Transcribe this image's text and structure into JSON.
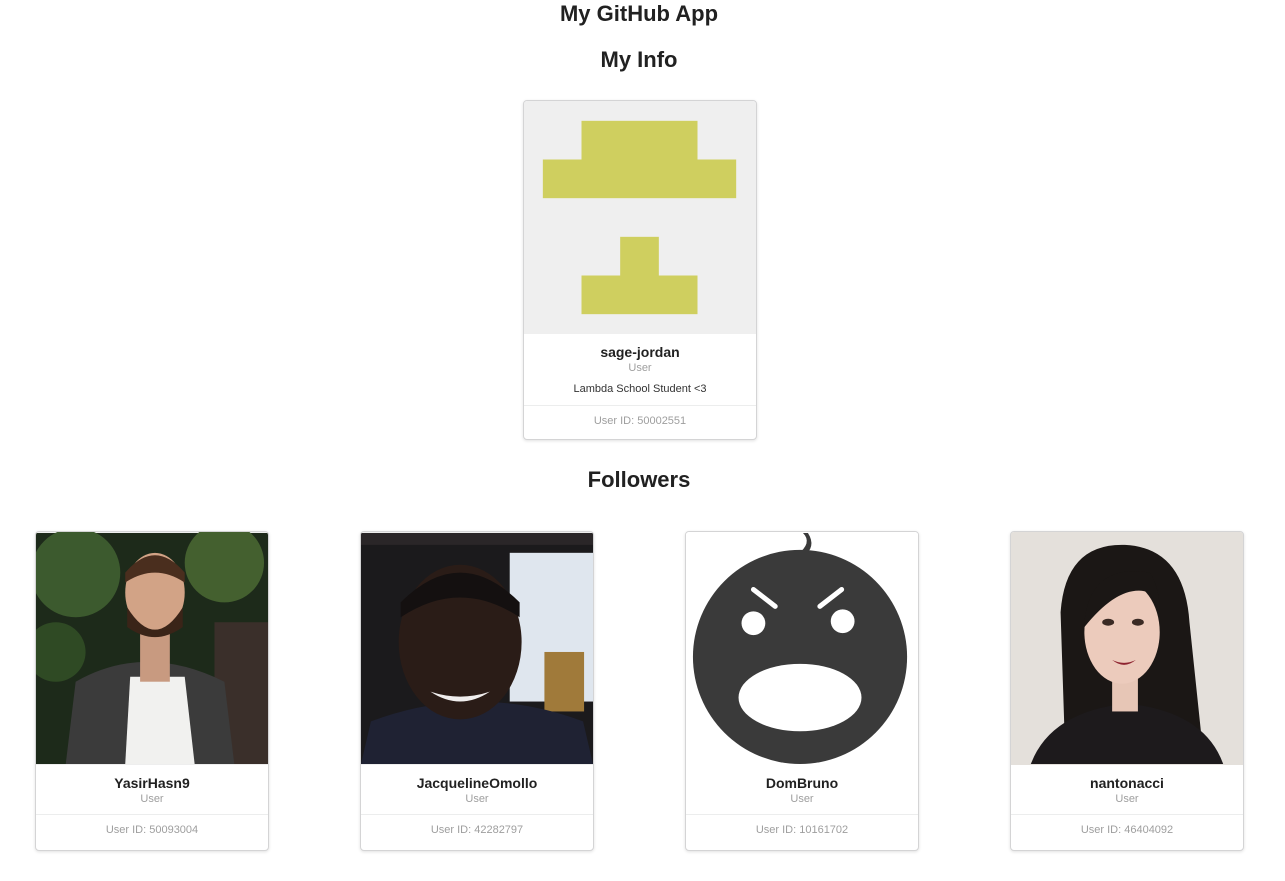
{
  "app": {
    "title": "My GitHub App"
  },
  "sections": {
    "my_info": "My Info",
    "followers": "Followers"
  },
  "me": {
    "login": "sage-jordan",
    "type": "User",
    "bio": "Lambda School Student <3",
    "user_id": "User ID: 50002551",
    "avatar_color": "#cfcf5f"
  },
  "followers": [
    {
      "login": "YasirHasn9",
      "type": "User",
      "user_id": "User ID: 50093004"
    },
    {
      "login": "JacquelineOmollo",
      "type": "User",
      "user_id": "User ID: 42282797"
    },
    {
      "login": "DomBruno",
      "type": "User",
      "user_id": "User ID: 10161702"
    },
    {
      "login": "nantonacci",
      "type": "User",
      "user_id": "User ID: 46404092"
    }
  ]
}
